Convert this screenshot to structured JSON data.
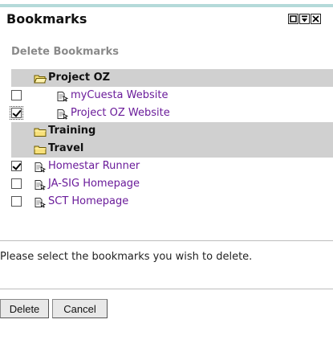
{
  "window": {
    "title": "Bookmarks",
    "controls": [
      "minimize-icon",
      "maximize-icon",
      "close-icon"
    ]
  },
  "subtitle": "Delete Bookmarks",
  "tree": [
    {
      "type": "folder",
      "label": "Project OZ",
      "open": true,
      "level": 0
    },
    {
      "type": "bookmark",
      "label": "myCuesta Website",
      "checked": false,
      "level": 1
    },
    {
      "type": "bookmark",
      "label": "Project OZ Website",
      "checked": true,
      "focus": true,
      "level": 1
    },
    {
      "type": "folder",
      "label": "Training",
      "open": false,
      "level": 0
    },
    {
      "type": "folder",
      "label": "Travel",
      "open": false,
      "level": 0
    },
    {
      "type": "bookmark",
      "label": "Homestar Runner",
      "checked": true,
      "level": 0
    },
    {
      "type": "bookmark",
      "label": "JA-SIG Homepage",
      "checked": false,
      "level": 0
    },
    {
      "type": "bookmark",
      "label": "SCT Homepage",
      "checked": false,
      "level": 0
    }
  ],
  "message": "Please select the bookmarks you wish to delete.",
  "buttons": {
    "delete": "Delete",
    "cancel": "Cancel"
  },
  "colors": {
    "accent": "#b4dad9",
    "folder_row": "#d0d0d0",
    "link": "#6a1b9a",
    "subtitle": "#8a8a8a"
  }
}
